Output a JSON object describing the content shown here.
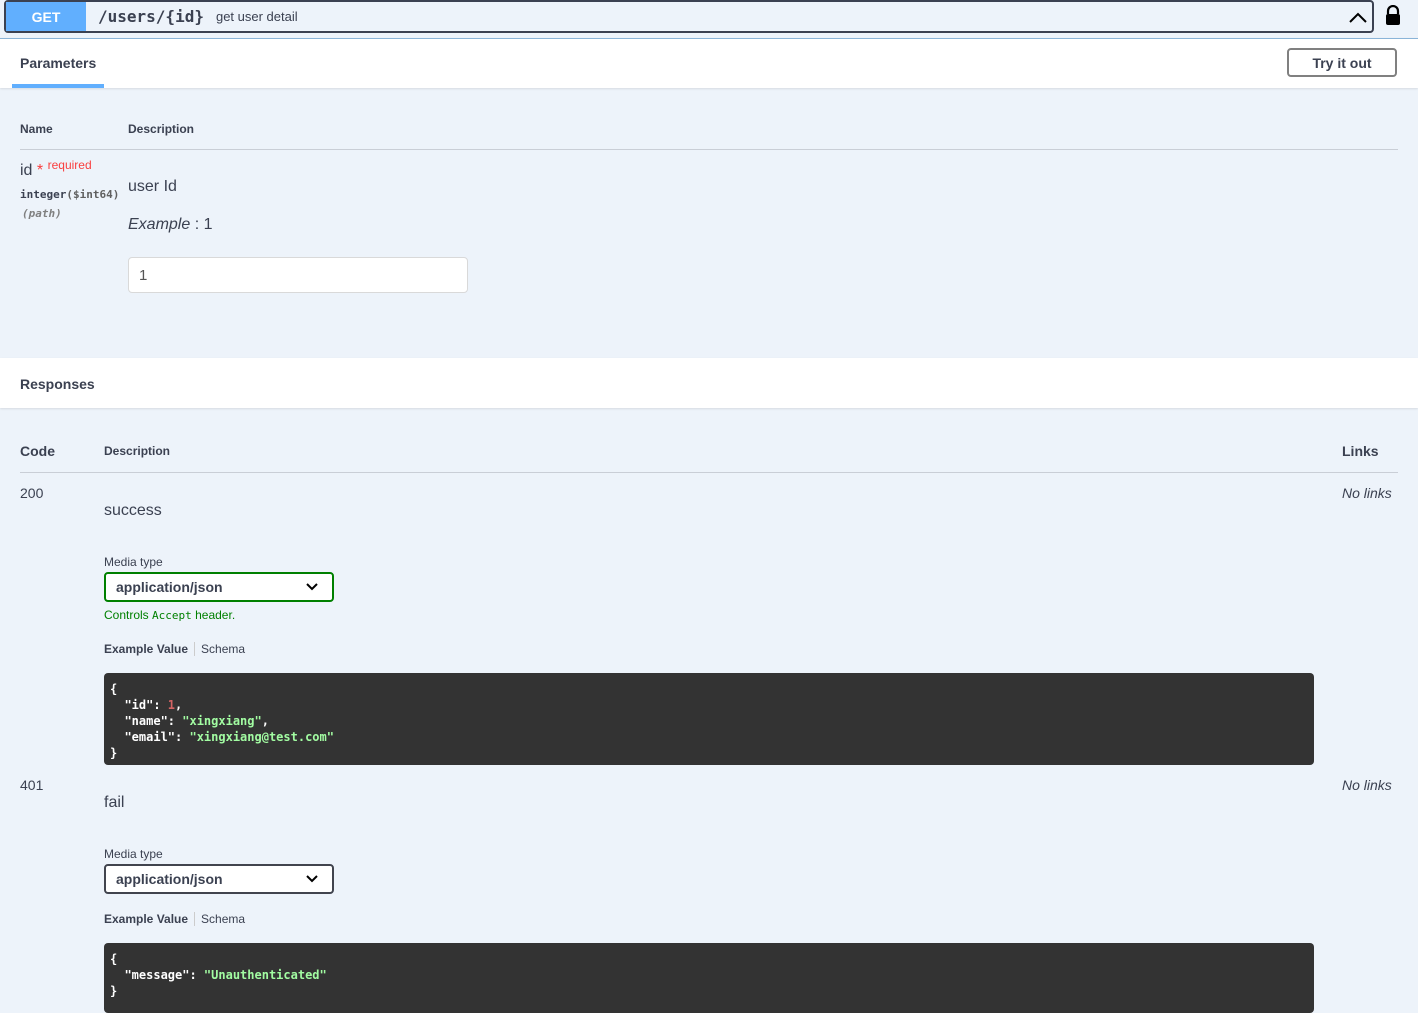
{
  "summary": {
    "method": "GET",
    "path": "/users/{id}",
    "description": "get user detail"
  },
  "parameters": {
    "title": "Parameters",
    "try_label": "Try it out",
    "col_name": "Name",
    "col_desc": "Description",
    "items": [
      {
        "name": "id",
        "star": "*",
        "required": "required",
        "type": "integer",
        "format": "($int64)",
        "in": "(path)",
        "description": "user Id",
        "example_label": "Example",
        "example_value": ": 1",
        "value": "1"
      }
    ]
  },
  "responses": {
    "title": "Responses",
    "col_code": "Code",
    "col_desc": "Description",
    "col_links": "Links",
    "items": [
      {
        "code": "200",
        "description": "success",
        "links": "No links",
        "media_label": "Media type",
        "media": "application/json",
        "controls_pre": "Controls ",
        "controls_code": "Accept",
        "controls_post": " header.",
        "tab_example": "Example Value",
        "tab_schema": "Schema"
      },
      {
        "code": "401",
        "description": "fail",
        "links": "No links",
        "media_label": "Media type",
        "media": "application/json",
        "tab_example": "Example Value",
        "tab_schema": "Schema"
      }
    ]
  },
  "colors": {
    "get": "#61affe",
    "required": "#f93e3e",
    "success": "#008000"
  }
}
